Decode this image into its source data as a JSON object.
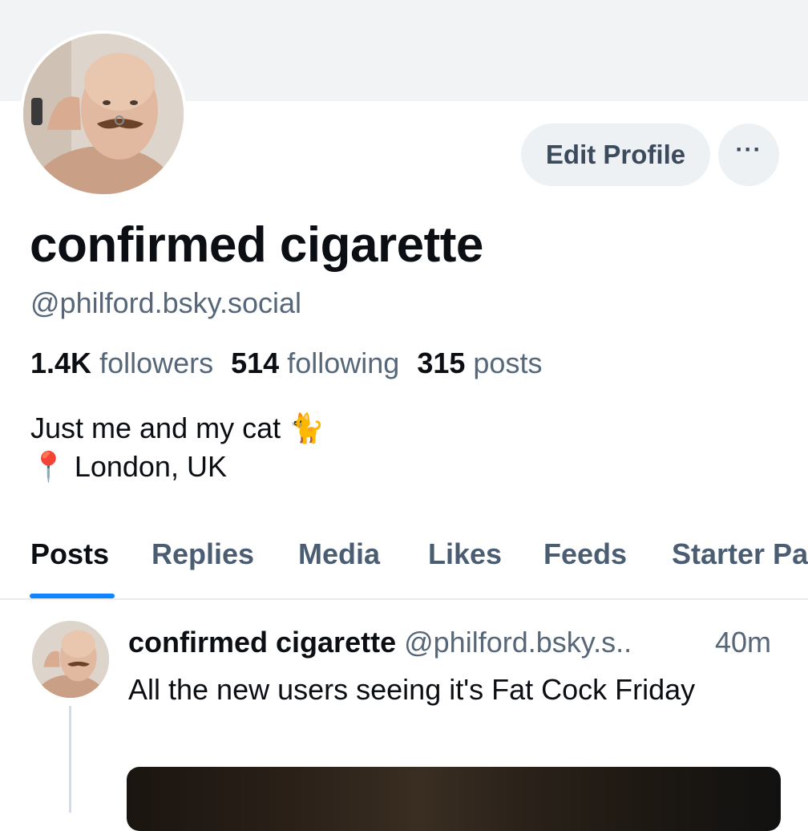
{
  "profile": {
    "display_name": "confirmed cigarette",
    "handle": "@philford.bsky.social",
    "edit_label": "Edit Profile",
    "more_label": "···",
    "stats": {
      "followers_count": "1.4K",
      "followers_label": "followers",
      "following_count": "514",
      "following_label": "following",
      "posts_count": "315",
      "posts_label": "posts"
    },
    "bio_line1": "Just me and my cat 🐈",
    "bio_line2": "📍 London, UK"
  },
  "tabs": [
    {
      "label": "Posts",
      "active": true
    },
    {
      "label": "Replies"
    },
    {
      "label": "Media"
    },
    {
      "label": "Likes"
    },
    {
      "label": "Feeds"
    },
    {
      "label": "Starter Pa"
    }
  ],
  "post": {
    "author_name": "confirmed cigarette",
    "author_handle": "@philford.bsky.s..",
    "time": "40m",
    "text": "All the new users seeing it's Fat Cock Friday"
  },
  "colors": {
    "accent": "#1083fe",
    "muted_text": "#566779",
    "button_bg": "#eef1f4",
    "banner_bg": "#f1f3f5"
  }
}
